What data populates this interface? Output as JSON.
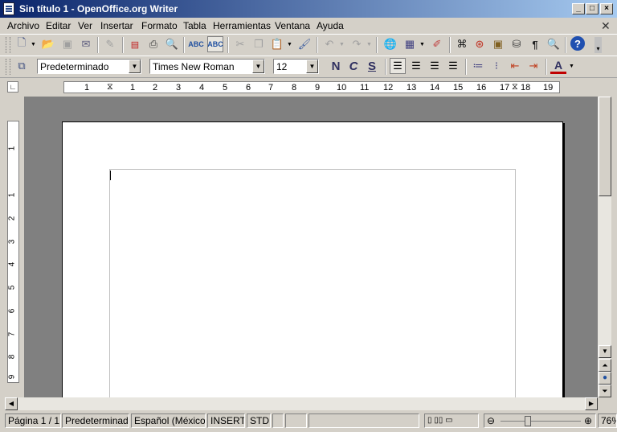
{
  "window": {
    "title": "Sin título 1 - OpenOffice.org Writer"
  },
  "menu": {
    "items": [
      "Archivo",
      "Editar",
      "Ver",
      "Insertar",
      "Formato",
      "Tabla",
      "Herramientas",
      "Ventana",
      "Ayuda"
    ]
  },
  "format_toolbar": {
    "style": "Predeterminado",
    "font": "Times New Roman",
    "size": "12",
    "bold": "N",
    "italic": "C",
    "underline": "S"
  },
  "ruler": {
    "h_labels": [
      "1",
      "1",
      "2",
      "3",
      "4",
      "5",
      "6",
      "7",
      "8",
      "9",
      "10",
      "11",
      "12",
      "13",
      "14",
      "15",
      "16",
      "17",
      "18",
      "19"
    ],
    "v_labels": [
      "1",
      "1",
      "2",
      "3",
      "4",
      "5",
      "6",
      "7",
      "8",
      "9"
    ]
  },
  "icons": {
    "standard": [
      "new-document-icon",
      "open-folder-icon",
      "save-icon",
      "email-icon",
      "edit-file-icon",
      "export-pdf-icon",
      "print-icon",
      "page-preview-icon",
      "spellcheck-icon",
      "autospellcheck-icon",
      "cut-icon",
      "copy-icon",
      "paste-icon",
      "clone-format-icon",
      "undo-icon",
      "redo-icon",
      "hyperlink-icon",
      "table-icon",
      "draw-functions-icon",
      "find-replace-icon",
      "navigator-icon",
      "gallery-icon",
      "data-sources-icon",
      "nonprinting-chars-icon",
      "zoom-icon",
      "help-icon"
    ],
    "accent": "#0a246a"
  },
  "status": {
    "page": "Página  1 / 1",
    "style": "Predeterminado",
    "language": "Español (México)",
    "mode": "INSERT",
    "selection": "STD",
    "zoom": "76%"
  }
}
